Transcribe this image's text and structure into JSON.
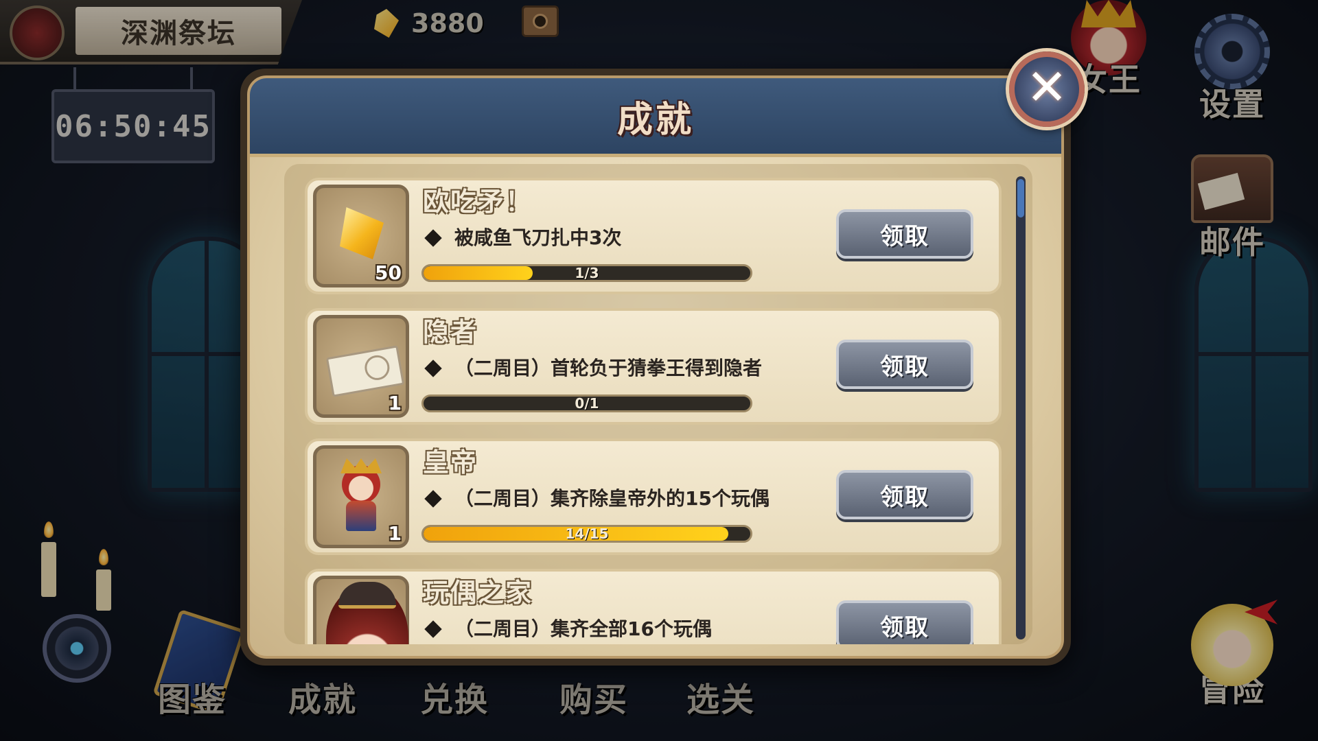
{
  "location": {
    "name": "深渊祭坛"
  },
  "currency": {
    "amount": "3880",
    "icon": "gem-icon"
  },
  "timer": "06:50:45",
  "side_menu": {
    "queen": "女王",
    "settings": "设置",
    "mail": "邮件",
    "adventure": "冒险"
  },
  "bottom_nav": [
    "图鉴",
    "成就",
    "兑换",
    "购买",
    "选关"
  ],
  "dialog": {
    "title": "成就",
    "close_symbol": "✕",
    "achievements": [
      {
        "title": "欧吃矛！",
        "description": "被咸鱼飞刀扎中3次",
        "progress_text": "1/3",
        "progress": 0.333,
        "reward_icon": "crystal-icon",
        "reward_count": "50",
        "button": "领取"
      },
      {
        "title": "隐者",
        "description": "（二周目）首轮负于猜拳王得到隐者",
        "progress_text": "0/1",
        "progress": 0,
        "reward_icon": "ticket-icon",
        "reward_count": "1",
        "button": "领取"
      },
      {
        "title": "皇帝",
        "description": "（二周目）集齐除皇帝外的15个玩偶",
        "progress_text": "14/15",
        "progress": 0.933,
        "reward_icon": "emperor-icon",
        "reward_count": "1",
        "button": "领取"
      },
      {
        "title": "玩偶之家",
        "description": "（二周目）集齐全部16个玩偶",
        "progress_text": "",
        "progress": 0,
        "reward_icon": "doll-icon",
        "reward_count": "",
        "button": "领取"
      }
    ]
  },
  "colors": {
    "progress_fill": "#f0a20c",
    "header": "#3f5a7c",
    "scroll_thumb": "#4a77b8"
  }
}
